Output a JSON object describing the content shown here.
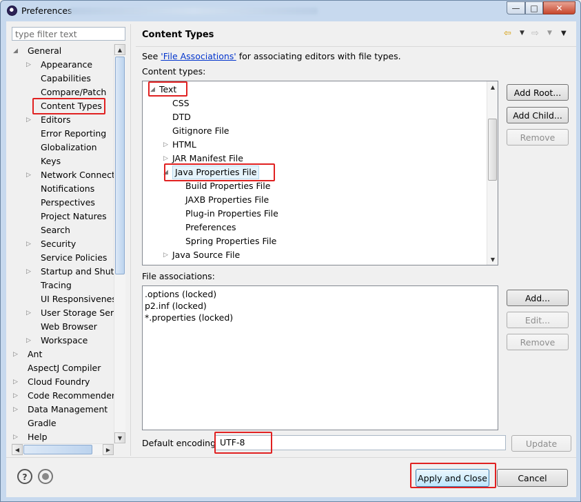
{
  "window": {
    "title": "Preferences"
  },
  "left": {
    "filter_placeholder": "type filter text",
    "tree": [
      {
        "label": "General",
        "expanded": true
      },
      {
        "label": "Appearance"
      },
      {
        "label": "Capabilities"
      },
      {
        "label": "Compare/Patch"
      },
      {
        "label": "Content Types",
        "selected": true
      },
      {
        "label": "Editors"
      },
      {
        "label": "Error Reporting"
      },
      {
        "label": "Globalization"
      },
      {
        "label": "Keys"
      },
      {
        "label": "Network Connecti"
      },
      {
        "label": "Notifications"
      },
      {
        "label": "Perspectives"
      },
      {
        "label": "Project Natures"
      },
      {
        "label": "Search"
      },
      {
        "label": "Security"
      },
      {
        "label": "Service Policies"
      },
      {
        "label": "Startup and Shutd"
      },
      {
        "label": "Tracing"
      },
      {
        "label": "UI Responsiveness"
      },
      {
        "label": "User Storage Serv"
      },
      {
        "label": "Web Browser"
      },
      {
        "label": "Workspace"
      },
      {
        "label": "Ant"
      },
      {
        "label": "AspectJ Compiler"
      },
      {
        "label": "Cloud Foundry"
      },
      {
        "label": "Code Recommenders"
      },
      {
        "label": "Data Management"
      },
      {
        "label": "Gradle"
      },
      {
        "label": "Help"
      }
    ]
  },
  "main": {
    "title": "Content Types",
    "see_prefix": "See ",
    "see_link": "'File Associations'",
    "see_suffix": " for associating editors with file types.",
    "content_types_label": "Content types:",
    "content_types": [
      {
        "label": "Text"
      },
      {
        "label": "CSS"
      },
      {
        "label": "DTD"
      },
      {
        "label": "Gitignore File"
      },
      {
        "label": "HTML"
      },
      {
        "label": "JAR Manifest File"
      },
      {
        "label": "Java Properties File",
        "selected": true
      },
      {
        "label": "Build Properties File"
      },
      {
        "label": "JAXB Properties File"
      },
      {
        "label": "Plug-in Properties File"
      },
      {
        "label": "Preferences"
      },
      {
        "label": "Spring Properties File"
      },
      {
        "label": "Java Source File"
      }
    ],
    "add_root": "Add Root...",
    "add_child": "Add Child...",
    "remove": "Remove",
    "file_assoc_label": "File associations:",
    "file_associations": [
      ".options (locked)",
      "p2.inf (locked)",
      "*.properties (locked)"
    ],
    "add": "Add...",
    "edit": "Edit...",
    "remove2": "Remove",
    "default_encoding_label": "Default encoding:",
    "default_encoding_value": "UTF-8",
    "update": "Update"
  },
  "footer": {
    "apply_close": "Apply and Close",
    "cancel": "Cancel"
  }
}
